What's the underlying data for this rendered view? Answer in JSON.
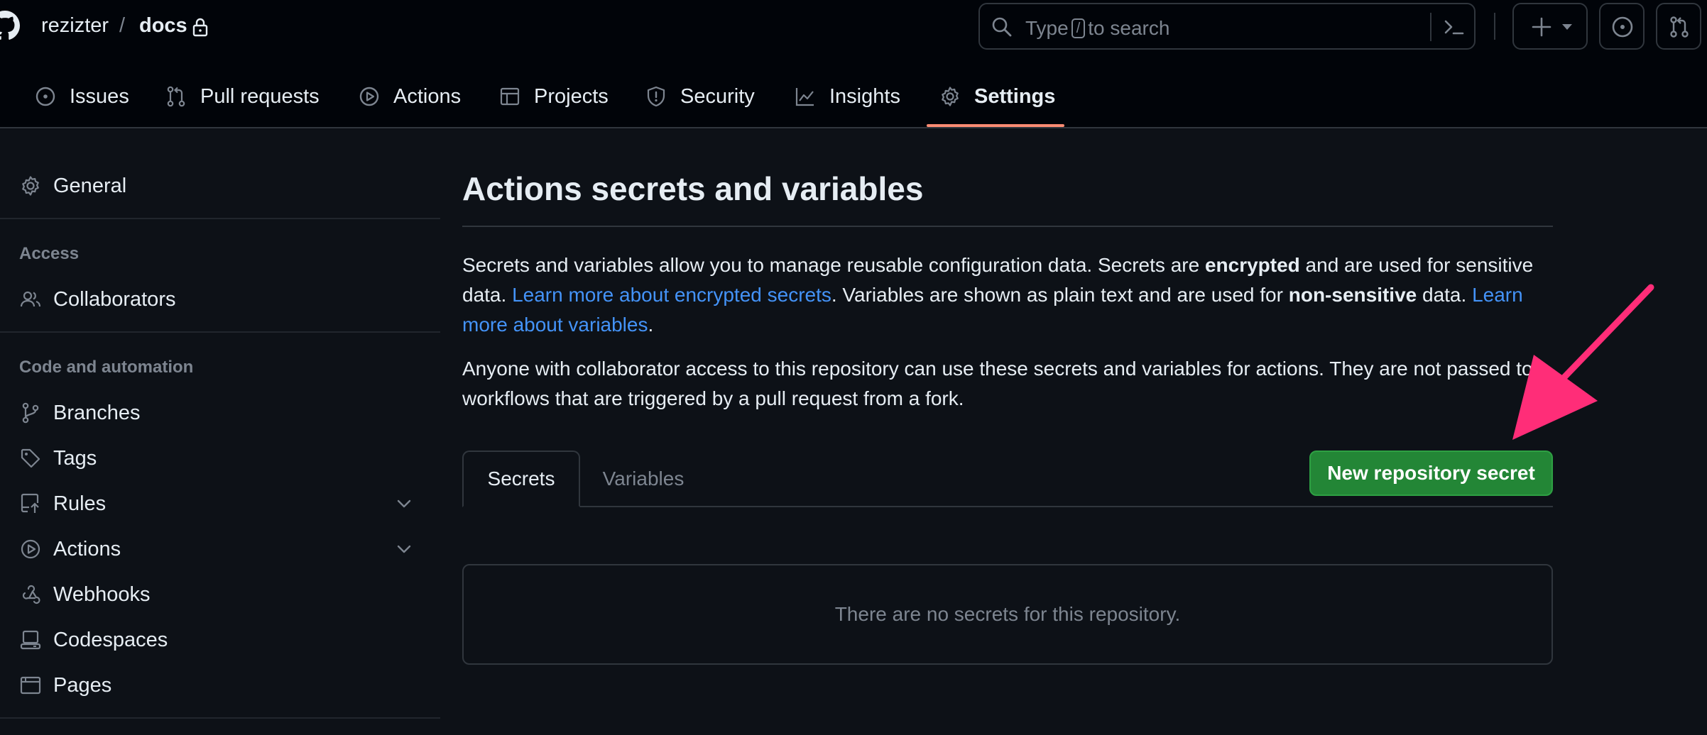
{
  "header": {
    "owner": "rezizter",
    "separator": "/",
    "repo": "docs",
    "search": {
      "text_before": "Type",
      "shortcut": "/",
      "text_after": "to search"
    }
  },
  "repo_nav": [
    {
      "label": "Issues",
      "icon": "issue-icon"
    },
    {
      "label": "Pull requests",
      "icon": "pull-request-icon"
    },
    {
      "label": "Actions",
      "icon": "play-icon"
    },
    {
      "label": "Projects",
      "icon": "table-icon"
    },
    {
      "label": "Security",
      "icon": "shield-icon"
    },
    {
      "label": "Insights",
      "icon": "graph-icon"
    },
    {
      "label": "Settings",
      "icon": "gear-icon",
      "active": true
    }
  ],
  "sidebar": {
    "general": "General",
    "access_heading": "Access",
    "collaborators": "Collaborators",
    "code_heading": "Code and automation",
    "items": [
      "Branches",
      "Tags",
      "Rules",
      "Actions",
      "Webhooks",
      "Codespaces",
      "Pages"
    ]
  },
  "main": {
    "title": "Actions secrets and variables",
    "p1": {
      "t1": "Secrets and variables allow you to manage reusable configuration data. Secrets are ",
      "b1": "encrypted",
      "t2": " and are used for sensitive data. ",
      "link1": "Learn more about encrypted secrets",
      "t3": ". Variables are shown as plain text and are used for ",
      "b2": "non-sensitive",
      "t4": " data. ",
      "link2": "Learn more about variables",
      "t5": "."
    },
    "p2": "Anyone with collaborator access to this repository can use these secrets and variables for actions. They are not passed to workflows that are triggered by a pull request from a fork.",
    "tabs": [
      "Secrets",
      "Variables"
    ],
    "new_secret_button": "New repository secret",
    "empty_message": "There are no secrets for this repository."
  },
  "colors": {
    "background": "#0d1117",
    "header": "#010409",
    "link": "#4493f8",
    "primary_button": "#238636",
    "active_tab_underline": "#fd8c73",
    "annotation_arrow": "#ff2d78"
  }
}
